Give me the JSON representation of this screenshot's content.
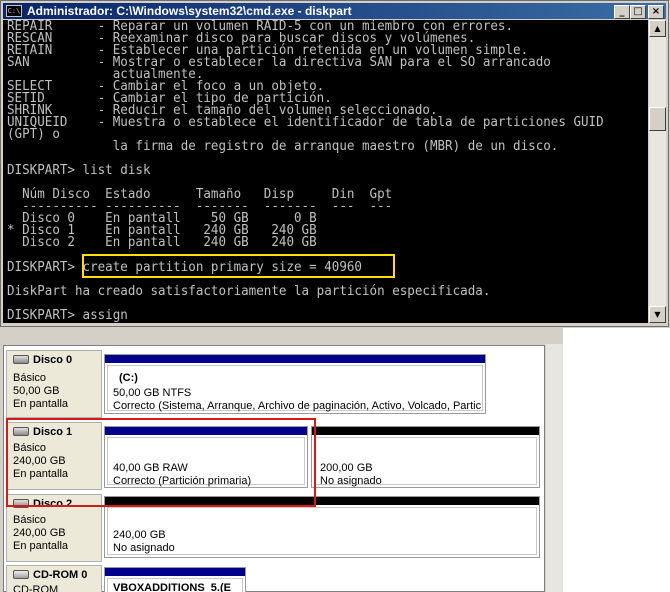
{
  "window": {
    "title": "Administrador: C:\\Windows\\system32\\cmd.exe - diskpart",
    "icon_text": "C:\\",
    "minimize": "_",
    "maximize": "□",
    "close": "×"
  },
  "console": {
    "lines": [
      "REPAIR      - Reparar un volumen RAID-5 con un miembro con errores.",
      "RESCAN      - Reexaminar disco para buscar discos y volúmenes.",
      "RETAIN      - Establecer una partición retenida en un volumen simple.",
      "SAN         - Mostrar o establecer la directiva SAN para el SO arrancado",
      "              actualmente.",
      "SELECT      - Cambiar el foco a un objeto.",
      "SETID       - Cambiar el tipo de partición.",
      "SHRINK      - Reducir el tamaño del volumen seleccionado.",
      "UNIQUEID    - Muestra o establece el identificador de tabla de particiones GUID",
      "(GPT) o",
      "              la firma de registro de arranque maestro (MBR) de un disco.",
      "",
      "DISKPART> list disk",
      "",
      "  Núm Disco  Estado      Tamaño   Disp     Din  Gpt",
      "  ---------- ----------  -------  -------  ---  ---",
      "  Disco 0    En pantall    50 GB      0 B",
      "* Disco 1    En pantall   240 GB   240 GB",
      "  Disco 2    En pantall   240 GB   240 GB",
      "",
      "DISKPART> create partition primary size = 40960",
      "",
      "DiskPart ha creado satisfactoriamente la partición especificada.",
      "",
      "DISKPART> assign"
    ],
    "scroll_up": "▲",
    "scroll_down": "▼"
  },
  "disks": [
    {
      "name": "Disco 0",
      "type": "Básico",
      "size": "50,00 GB",
      "status": "En pantalla",
      "partitions": [
        {
          "title": "(C:)",
          "line1": "50,00 GB NTFS",
          "line2": "Correcto (Sistema, Arranque, Archivo de paginación, Activo, Volcado, Partic"
        }
      ]
    },
    {
      "name": "Disco 1",
      "type": "Básico",
      "size": "240,00 GB",
      "status": "En pantalla",
      "partitions": [
        {
          "line1": "40,00 GB RAW",
          "line2": "Correcto (Partición primaria)"
        },
        {
          "line1": "200,00 GB",
          "line2": "No asignado"
        }
      ]
    },
    {
      "name": "Disco 2",
      "type": "Básico",
      "size": "240,00 GB",
      "status": "En pantalla",
      "partitions": [
        {
          "line1": "240,00 GB",
          "line2": "No asignado"
        }
      ]
    },
    {
      "name": "CD-ROM 0",
      "type": "CD-ROM",
      "partitions": [
        {
          "title": "VBOXADDITIONS_5.(E"
        }
      ]
    }
  ],
  "colors": {
    "console_bg": "#000000",
    "console_text": "#c0c0c0",
    "command_highlight": "#ffe000",
    "annotation_box": "#d61a1a",
    "primary_partition_bar": "#00008b",
    "unallocated_bar": "#000000"
  }
}
